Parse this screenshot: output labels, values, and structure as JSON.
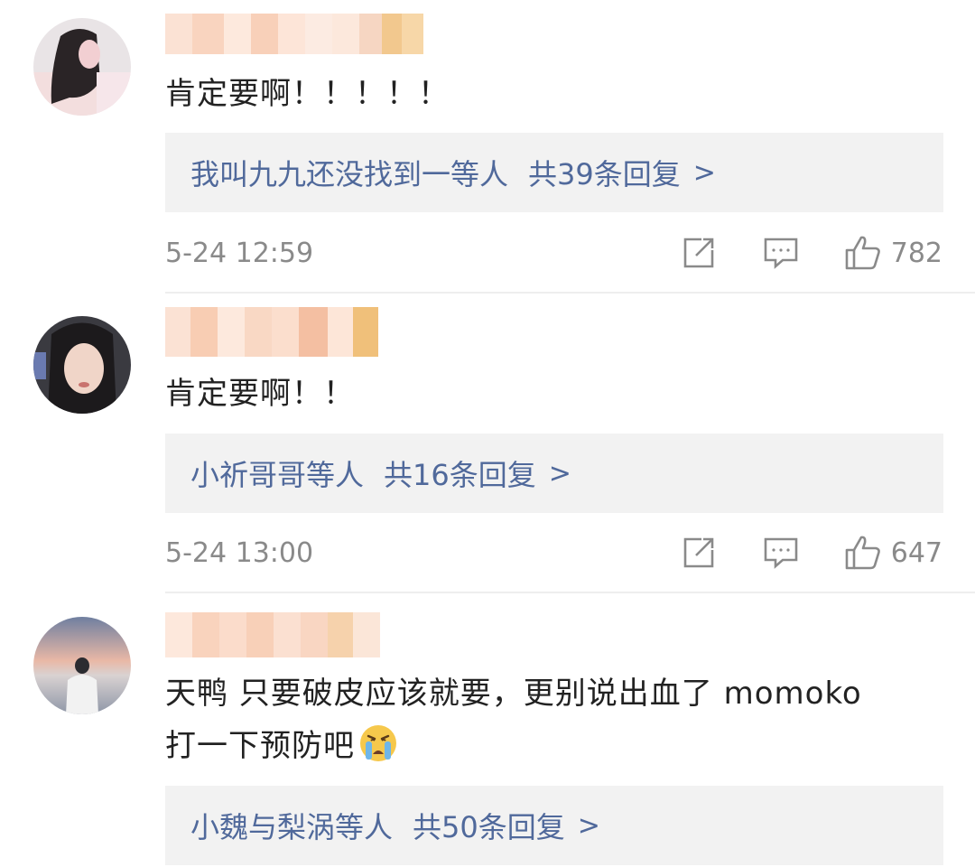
{
  "comments": [
    {
      "text": "肯定要啊！！！！！",
      "reply_names": "我叫九九还没找到一等人",
      "reply_count": "共39条回复",
      "reply_chevron": ">",
      "time": "5-24 12:59",
      "likes": "782"
    },
    {
      "text": "肯定要啊！！",
      "reply_names": "小祈哥哥等人",
      "reply_count": "共16条回复",
      "reply_chevron": ">",
      "time": "5-24 13:00",
      "likes": "647"
    },
    {
      "text_line1": "天鸭 只要破皮应该就要，更别说出血了 momoko",
      "text_line2": "打一下预防吧",
      "reply_names": "小魏与梨涡等人",
      "reply_count": "共50条回复",
      "reply_chevron": ">"
    }
  ],
  "icons": {
    "share": "share-icon",
    "comment": "comment-icon",
    "like": "thumbs-up-icon",
    "crying_emoji": "crying-face-emoji"
  },
  "colors": {
    "link_blue": "#50699b",
    "meta_gray": "#8a8a8a",
    "reply_bg": "#f2f2f2",
    "name_blur_peach": "#f7c9a8",
    "name_blur_gold": "#f0c27a"
  }
}
